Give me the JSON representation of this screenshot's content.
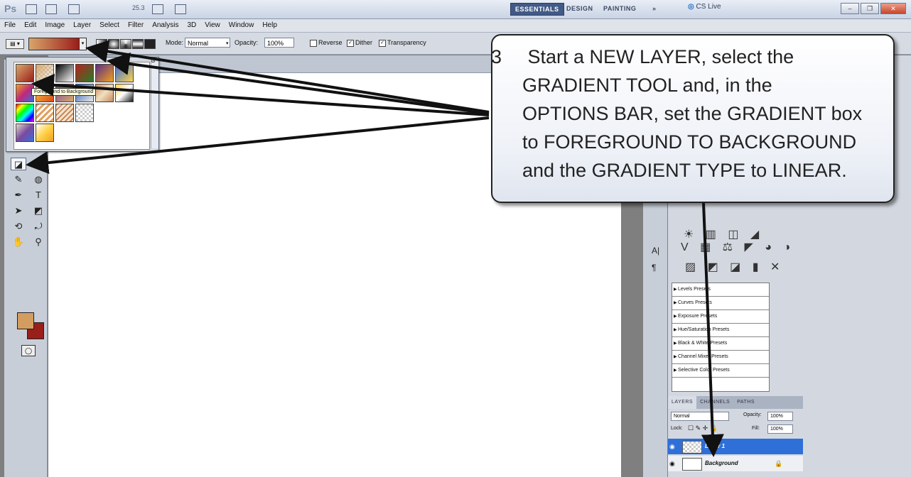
{
  "appbar": {
    "app_logo": "Ps",
    "zoom": "25.3",
    "workspaces": [
      "ESSENTIALS",
      "DESIGN",
      "PAINTING",
      "»"
    ],
    "cs_live": "CS Live",
    "window_buttons": [
      "minimize",
      "restore",
      "close"
    ]
  },
  "menubar": [
    "File",
    "Edit",
    "Image",
    "Layer",
    "Select",
    "Filter",
    "Analysis",
    "3D",
    "View",
    "Window",
    "Help"
  ],
  "options_bar": {
    "mode_label": "Mode:",
    "mode_value": "Normal",
    "opacity_label": "Opacity:",
    "opacity_value": "100%",
    "reverse_label": "Reverse",
    "dither_label": "Dither",
    "transparency_label": "Transparency",
    "dither_checked": true,
    "transparency_checked": true
  },
  "gradient_picker": {
    "tooltip": "Foreground to Background",
    "swatch_colors": [
      "#d8a86a",
      "#1a1a1a",
      "#b8221e",
      "#5a2c86",
      "#f0a020",
      "#3a6fd8",
      "#ffd24a",
      "#c98a5a",
      "#7a4aa0",
      "#e0d8c8"
    ]
  },
  "colors": {
    "foreground": "#d39d5f",
    "background": "#9a1e1a",
    "layer_selected": "#2f6fd8"
  },
  "panels": {
    "adjustment_presets": [
      "Levels Presets",
      "Curves Presets",
      "Exposure Presets",
      "Hue/Saturation Presets",
      "Black & White Presets",
      "Channel Mixer Presets",
      "Selective Color Presets"
    ],
    "layer_tabs": [
      "LAYERS",
      "CHANNELS",
      "PATHS"
    ],
    "blend_mode": "Normal",
    "opacity_label": "Opacity:",
    "opacity_value": "100%",
    "lock_label": "Lock:",
    "fill_label": "Fill:",
    "fill_value": "100%",
    "layers": [
      {
        "name": "Layer 1",
        "selected": true
      },
      {
        "name": "Background",
        "selected": false
      }
    ]
  },
  "callout": {
    "number": "3",
    "lines": [
      "Start a NEW LAYER, select the",
      "GRADIENT TOOL and, in the",
      "OPTIONS BAR, set the GRADIENT box",
      "to FOREGROUND TO BACKGROUND",
      "and the GRADIENT TYPE to LINEAR."
    ]
  }
}
